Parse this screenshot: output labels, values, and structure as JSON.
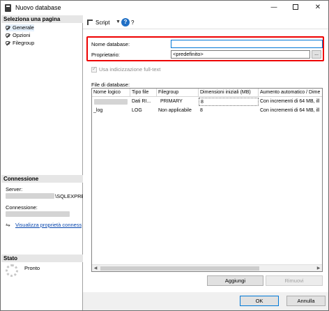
{
  "window": {
    "title": "Nuovo database",
    "minimize": "—",
    "close": "✕"
  },
  "left": {
    "select_page_header": "Seleziona una pagina",
    "pages": [
      {
        "label": "Generale",
        "icon": "wrench-icon"
      },
      {
        "label": "Opzioni",
        "icon": "wrench-icon"
      },
      {
        "label": "Filegroup",
        "icon": "wrench-icon"
      }
    ],
    "connection_header": "Connessione",
    "server_label": "Server:",
    "server_value": "\\SQLEXPRE",
    "connection_label": "Connessione:",
    "view_props_link": "Visualizza proprietà connessione",
    "status_header": "Stato",
    "status_value": "Pronto"
  },
  "toolbar": {
    "script_label": "Script",
    "dropdown_arrow": "▼",
    "help_glyph": "?",
    "help_label": "?"
  },
  "form": {
    "db_name_label": "Nome database:",
    "db_name_value": "",
    "owner_label": "Proprietario:",
    "owner_value": "<predefinito>",
    "browse_label": "...",
    "fulltext_label": "Usa indicizzazione full-text",
    "files_label": "File di database:"
  },
  "grid": {
    "columns": [
      "Nome logico",
      "Tipo file",
      "Filegroup",
      "Dimensioni iniziali (MB)",
      "Aumento automatico / Dime"
    ],
    "rows": [
      {
        "logical_name": "",
        "file_type": "Dati RI...",
        "filegroup": "PRIMARY",
        "initial_size": "8",
        "autogrowth": "Con incrementi di 64 MB, ill"
      },
      {
        "logical_name": "_log",
        "file_type": "LOG",
        "filegroup": "Non applicabile",
        "initial_size": "8",
        "autogrowth": "Con incrementi di 64 MB, ill"
      }
    ],
    "scroll_left": "◀",
    "scroll_right": "▶"
  },
  "buttons": {
    "add": "Aggiungi",
    "remove": "Rimuovi",
    "ok": "OK",
    "cancel": "Annulla"
  },
  "colors": {
    "highlight": "#e00000",
    "link": "#0645ad",
    "focus": "#0078d7"
  }
}
